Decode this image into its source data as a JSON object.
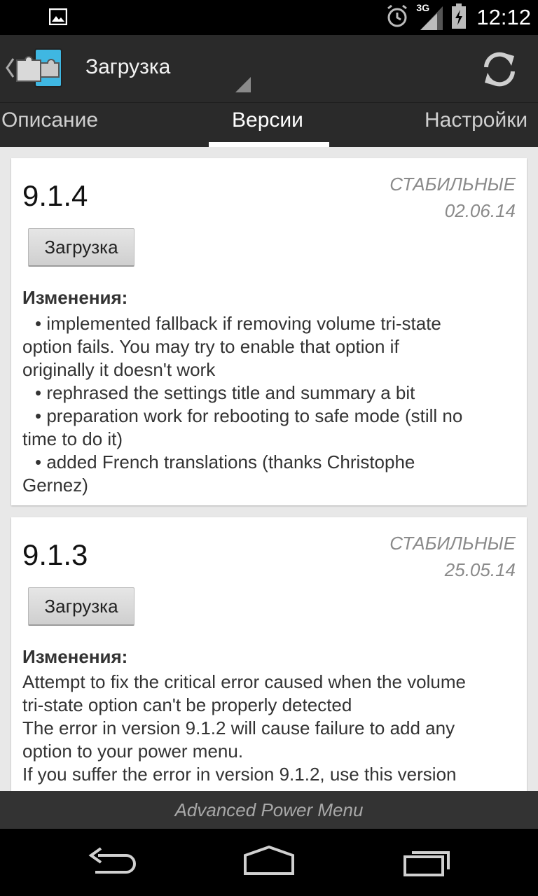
{
  "status_bar": {
    "time": "12:12",
    "network": "3G",
    "icons": [
      "image-notification-icon",
      "alarm-icon",
      "signal-icon",
      "battery-charging-icon"
    ]
  },
  "action_bar": {
    "title": "Загрузка",
    "icons": [
      "back-chevron-icon",
      "puzzle-app-icon",
      "spinner-triangle-icon",
      "refresh-icon"
    ]
  },
  "tabs": [
    {
      "label": "Описание"
    },
    {
      "label": "Версии"
    },
    {
      "label": "Настройки"
    }
  ],
  "versions": [
    {
      "version": "9.1.4",
      "channel": "СТАБИЛЬНЫЕ",
      "date": "02.06.14",
      "download_label": "Загрузка",
      "changes_label": "Изменения:",
      "changes": [
        "• implemented fallback if removing volume tri-state",
        "option fails. You may try to enable that option if",
        "originally it doesn't work",
        "• rephrased the settings title and summary a bit",
        "• preparation work for rebooting to safe mode (still no",
        "time to do it)",
        "• added French translations (thanks Christophe",
        "Gernez)"
      ]
    },
    {
      "version": "9.1.3",
      "channel": "СТАБИЛЬНЫЕ",
      "date": "25.05.14",
      "download_label": "Загрузка",
      "changes_label": "Изменения:",
      "changes": [
        "Attempt to fix the critical error caused when the volume",
        "tri-state option can't be properly detected",
        "The error in version 9.1.2 will cause failure to add any",
        "option to your power menu.",
        "If you suffer the error in version 9.1.2, use this version"
      ]
    }
  ],
  "footer": {
    "text": "Advanced Power Menu"
  },
  "nav_bar": {
    "icons": [
      "back-icon",
      "home-icon",
      "recent-apps-icon"
    ]
  },
  "colors": {
    "action_bar": "#2a2a2a",
    "status_bar": "#000000",
    "footer": "#333333",
    "background": "#e8e8e8"
  }
}
